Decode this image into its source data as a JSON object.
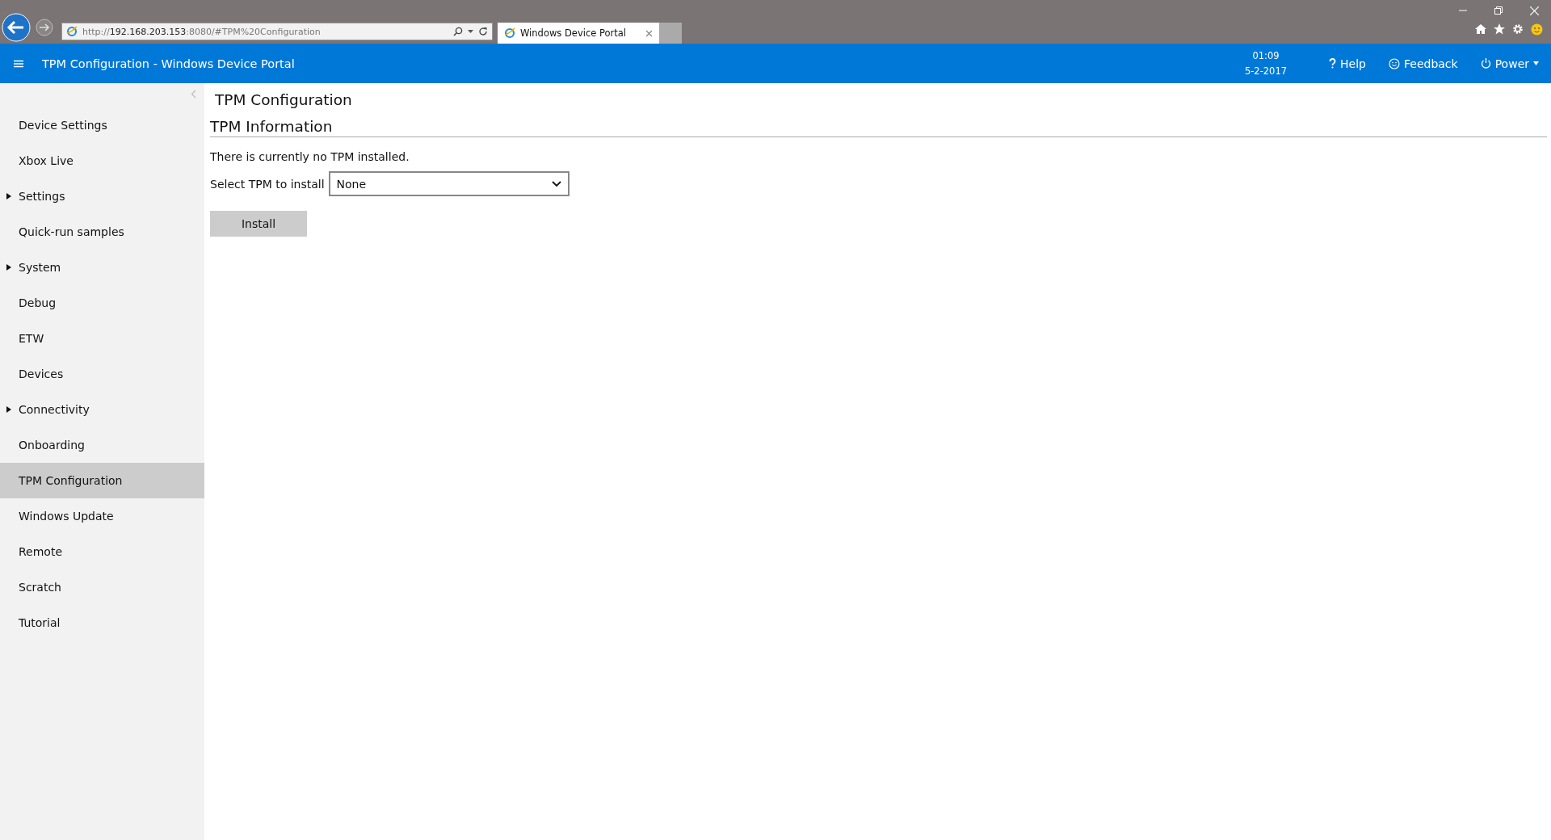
{
  "browser": {
    "address": {
      "scheme": "http://",
      "host": "192.168.203.153",
      "rest": ":8080/#TPM%20Configuration"
    },
    "tab": {
      "title": "Windows Device Portal"
    }
  },
  "header": {
    "title": "TPM Configuration - Windows Device Portal",
    "time": "01:09",
    "date": "5-2-2017",
    "help": "Help",
    "feedback": "Feedback",
    "power": "Power"
  },
  "sidebar": {
    "items": [
      {
        "label": "Device Settings",
        "expandable": false,
        "selected": false
      },
      {
        "label": "Xbox Live",
        "expandable": false,
        "selected": false
      },
      {
        "label": "Settings",
        "expandable": true,
        "selected": false
      },
      {
        "label": "Quick-run samples",
        "expandable": false,
        "selected": false
      },
      {
        "label": "System",
        "expandable": true,
        "selected": false
      },
      {
        "label": "Debug",
        "expandable": false,
        "selected": false
      },
      {
        "label": "ETW",
        "expandable": false,
        "selected": false
      },
      {
        "label": "Devices",
        "expandable": false,
        "selected": false
      },
      {
        "label": "Connectivity",
        "expandable": true,
        "selected": false
      },
      {
        "label": "Onboarding",
        "expandable": false,
        "selected": false
      },
      {
        "label": "TPM Configuration",
        "expandable": false,
        "selected": true
      },
      {
        "label": "Windows Update",
        "expandable": false,
        "selected": false
      },
      {
        "label": "Remote",
        "expandable": false,
        "selected": false
      },
      {
        "label": "Scratch",
        "expandable": false,
        "selected": false
      },
      {
        "label": "Tutorial",
        "expandable": false,
        "selected": false
      }
    ]
  },
  "main": {
    "title": "TPM Configuration",
    "section": "TPM Information",
    "status": "There is currently no TPM installed.",
    "select_label": "Select TPM to install",
    "select_value": "None",
    "install_button": "Install"
  }
}
